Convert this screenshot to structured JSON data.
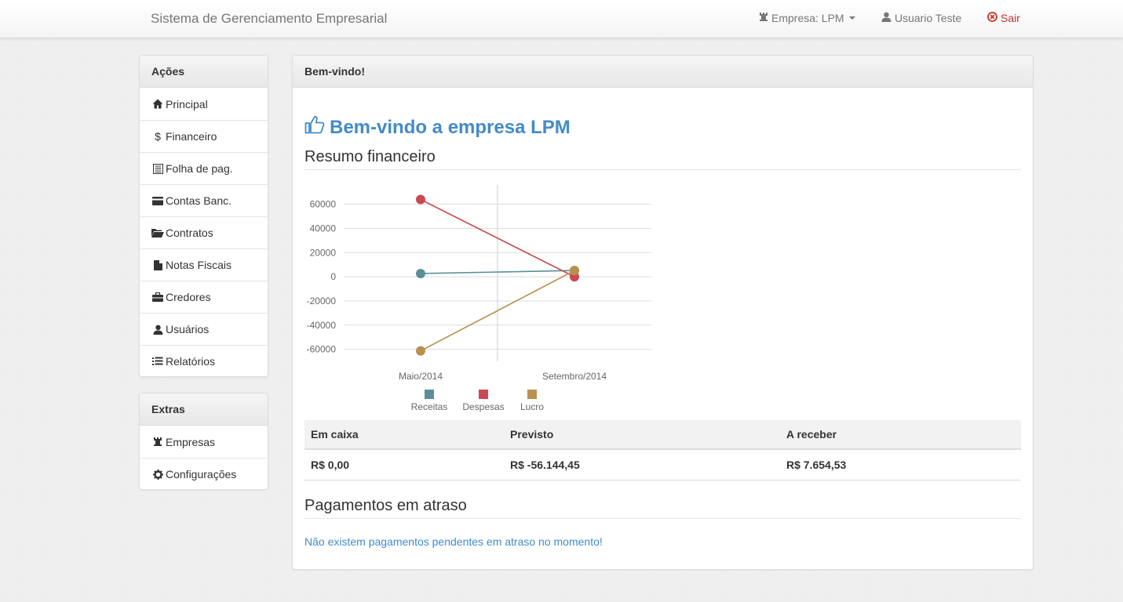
{
  "navbar": {
    "brand": "Sistema de Gerenciamento Empresarial",
    "empresa_label": "Empresa: LPM",
    "user_label": "Usuario Teste",
    "logout_label": "Sair"
  },
  "sidebar": {
    "acoes_title": "Ações",
    "acoes_items": [
      {
        "label": "Principal",
        "icon": "home-icon"
      },
      {
        "label": "Financeiro",
        "icon": "dollar-icon"
      },
      {
        "label": "Folha de pag.",
        "icon": "list-alt-icon"
      },
      {
        "label": "Contas Banc.",
        "icon": "credit-card-icon"
      },
      {
        "label": "Contratos",
        "icon": "folder-open-icon"
      },
      {
        "label": "Notas Fiscais",
        "icon": "file-icon"
      },
      {
        "label": "Credores",
        "icon": "briefcase-icon"
      },
      {
        "label": "Usuários",
        "icon": "user-icon"
      },
      {
        "label": "Relatórios",
        "icon": "list-icon"
      }
    ],
    "extras_title": "Extras",
    "extras_items": [
      {
        "label": "Empresas",
        "icon": "tower-icon"
      },
      {
        "label": "Configurações",
        "icon": "cog-icon"
      }
    ]
  },
  "main": {
    "panel_title": "Bem-vindo!",
    "welcome": "Bem-vindo a empresa LPM",
    "resumo_title": "Resumo financeiro",
    "table": {
      "headers": [
        "Em caixa",
        "Previsto",
        "A receber"
      ],
      "values": [
        "R$ 0,00",
        "R$ -56.144,45",
        "R$ 7.654,53"
      ]
    },
    "atraso_title": "Pagamentos em atraso",
    "atraso_message": "Não existem pagamentos pendentes em atraso no momento!"
  },
  "chart_data": {
    "type": "line",
    "categories": [
      "Maio/2014",
      "Setembro/2014"
    ],
    "series": [
      {
        "name": "Receitas",
        "color": "#5b8e99",
        "values": [
          2700,
          5200
        ]
      },
      {
        "name": "Despesas",
        "color": "#c94a53",
        "values": [
          64000,
          0
        ]
      },
      {
        "name": "Lucro",
        "color": "#b8904f",
        "values": [
          -61300,
          5200
        ]
      }
    ],
    "yticks": [
      60000,
      40000,
      20000,
      0,
      -20000,
      -40000,
      -60000
    ],
    "ylim": [
      -70000,
      76000
    ],
    "grid": true,
    "legend": "bottom"
  }
}
